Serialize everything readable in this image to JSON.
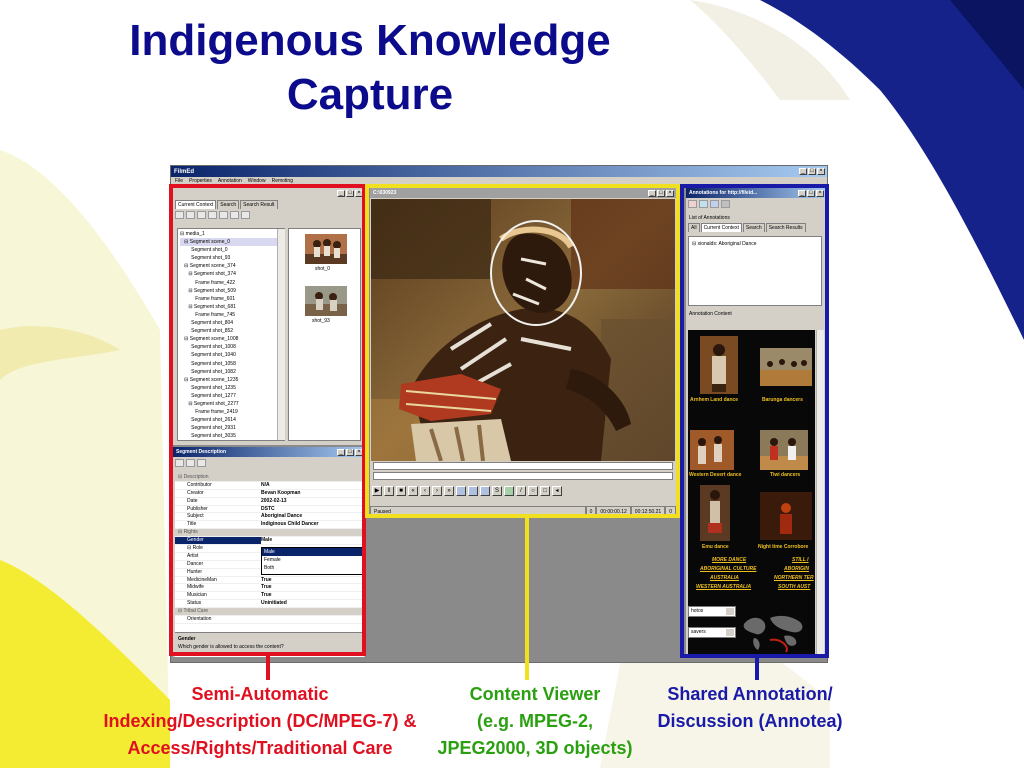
{
  "slide": {
    "title_line1": "Indigenous Knowledge",
    "title_line2": "Capture",
    "colors": {
      "title": "#0b0b8c",
      "red": "#e01020",
      "yellow": "#f0e020",
      "blue": "#1a1aa8",
      "green": "#2aa010",
      "navy": "#0c1a6a"
    }
  },
  "app": {
    "title": "FilmEd",
    "menu": [
      "File",
      "Properties",
      "Annotation",
      "Window",
      "Remoting"
    ]
  },
  "left_pane": {
    "tabs": [
      "Current Context",
      "Search",
      "Search Result"
    ],
    "tree": [
      "⊟ media_1",
      "   ⊟ Segment scene_0",
      "        Segment shot_0",
      "        Segment shot_93",
      "   ⊟ Segment scene_374",
      "      ⊟ Segment shot_374",
      "           Frame frame_422",
      "      ⊟ Segment shot_509",
      "           Frame frame_601",
      "      ⊟ Segment shot_681",
      "           Frame frame_745",
      "        Segment shot_804",
      "        Segment shot_852",
      "   ⊟ Segment scene_1008",
      "        Segment shot_1008",
      "        Segment shot_1040",
      "        Segment shot_1058",
      "        Segment shot_1082",
      "   ⊟ Segment scene_1235",
      "        Segment shot_1235",
      "        Segment shot_1277",
      "      ⊟ Segment shot_2277",
      "           Frame frame_2419",
      "        Segment shot_2614",
      "        Segment shot_2931",
      "        Segment shot_3035"
    ],
    "thumbs": [
      "shot_0",
      "shot_93"
    ]
  },
  "desc_pane": {
    "title": "Segment Description",
    "rows": [
      {
        "k": "⊟ Description",
        "v": "",
        "cat": true
      },
      {
        "k": "Contributor",
        "v": "N/A"
      },
      {
        "k": "Creator",
        "v": "Bevan Koopman"
      },
      {
        "k": "Date",
        "v": "2002-02-13"
      },
      {
        "k": "Publisher",
        "v": "DSTC"
      },
      {
        "k": "Subject",
        "v": "Aboriginal Dance"
      },
      {
        "k": "Title",
        "v": "Indiginous Child Dancer"
      },
      {
        "k": "⊟ Rights",
        "v": "",
        "cat": true
      },
      {
        "k": "Gender",
        "v": "Male",
        "sel": true
      },
      {
        "k": "⊟ Role",
        "v": ""
      },
      {
        "k": "Artist",
        "v": ""
      },
      {
        "k": "Dancer",
        "v": ""
      },
      {
        "k": "Hunter",
        "v": "True"
      },
      {
        "k": "MedicineMan",
        "v": "True"
      },
      {
        "k": "Midwife",
        "v": "True"
      },
      {
        "k": "Musician",
        "v": "True"
      },
      {
        "k": "Status",
        "v": "Uninitiated"
      },
      {
        "k": "⊟ Tribal Care",
        "v": "",
        "cat": true
      },
      {
        "k": "Orientation",
        "v": ""
      }
    ],
    "dropdown": [
      "Male",
      "Female",
      "Both"
    ],
    "help_title": "Gender",
    "help_text": "Which gender is allowed to access the content?"
  },
  "viewer": {
    "title": "C:\\030923",
    "status": "Paused",
    "frame": "0",
    "time": "00:00:00.12",
    "duration": "00:12:50.21",
    "end": "0"
  },
  "anno_pane": {
    "title": "Annotations for http://fileid...",
    "list_label": "List of Annotations",
    "tabs": [
      "All",
      "Current Context",
      "Search",
      "Search Results"
    ],
    "item": "xionalds: Aboriginal Dance",
    "content_label": "Annotation Content",
    "captions": [
      "Arnhem Land dance",
      "Barunga dancers",
      "Western Desert dance",
      "Tiwi dancers",
      "Emu dance",
      "Night time Corrobore"
    ],
    "links": [
      "MORE DANCE",
      "STILL I",
      "ABORIGINAL CULTURE",
      "ABORIGIN",
      "AUSTRALIA",
      "NORTHERN TER",
      "WESTERN AUSTRALIA",
      "SOUTH AUST"
    ],
    "select1": "hotos",
    "select2": "savers"
  },
  "captions": {
    "left": [
      "Semi-Automatic",
      "Indexing/Description (DC/MPEG-7) &",
      "Access/Rights/Traditional Care"
    ],
    "middle": [
      "Content Viewer",
      "(e.g. MPEG-2,",
      "JPEG2000, 3D objects)"
    ],
    "right": [
      "Shared Annotation/",
      "Discussion (Annotea)"
    ]
  }
}
